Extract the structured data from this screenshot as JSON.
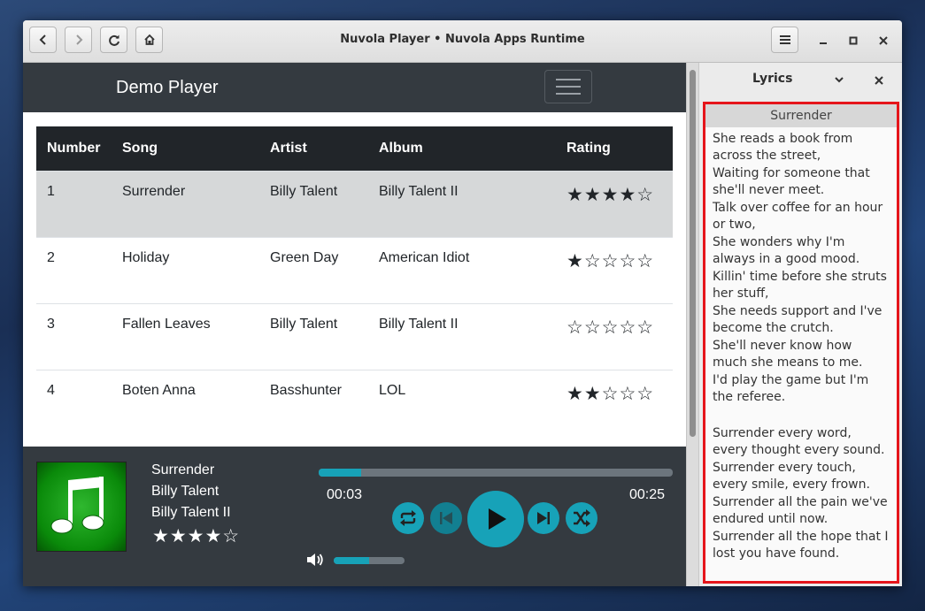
{
  "window": {
    "title": "Nuvola Player • Nuvola Apps Runtime"
  },
  "navbar": {
    "brand": "Demo Player"
  },
  "table": {
    "headers": [
      "Number",
      "Song",
      "Artist",
      "Album",
      "Rating"
    ],
    "rows": [
      {
        "number": "1",
        "song": "Surrender",
        "artist": "Billy Talent",
        "album": "Billy Talent II",
        "rating": "★★★★☆",
        "stars": 4
      },
      {
        "number": "2",
        "song": "Holiday",
        "artist": "Green Day",
        "album": "American Idiot",
        "rating": "★☆☆☆☆",
        "stars": 1
      },
      {
        "number": "3",
        "song": "Fallen Leaves",
        "artist": "Billy Talent",
        "album": "Billy Talent II",
        "rating": "☆☆☆☆☆",
        "stars": 0
      },
      {
        "number": "4",
        "song": "Boten Anna",
        "artist": "Basshunter",
        "album": "LOL",
        "rating": "★★☆☆☆",
        "stars": 2
      }
    ]
  },
  "player": {
    "song": "Surrender",
    "artist": "Billy Talent",
    "album": "Billy Talent II",
    "rating": "★★★★☆",
    "stars": 4,
    "elapsed": "00:03",
    "duration": "00:25",
    "progress_fraction": 0.12,
    "volume_fraction": 0.5,
    "accent_color": "#17a2b8"
  },
  "sidebar": {
    "title": "Lyrics",
    "lyrics_title": "Surrender",
    "lyrics": [
      "She reads a book from across the street,",
      "Waiting for someone that she'll never meet.",
      "Talk over coffee for an hour or two,",
      "She wonders why I'm always in a good mood.",
      "Killin' time before she struts her stuff,",
      "She needs support and I've become the crutch.",
      "She'll never know how much she means to me.",
      "I'd play the game but I'm the referee.",
      "",
      "Surrender every word, every thought every sound.",
      "Surrender every touch, every smile, every frown.",
      "Surrender all the pain we've endured until now.",
      "Surrender all the hope that I lost you have found."
    ]
  },
  "icons": {
    "back": "chevron-left-icon",
    "forward": "chevron-right-icon",
    "reload": "reload-icon",
    "home": "home-icon",
    "menu": "hamburger-menu-icon",
    "album_art": "music-note-icon"
  },
  "colors": {
    "highlight_border": "#e5151b",
    "navbar_bg": "#343a40"
  }
}
